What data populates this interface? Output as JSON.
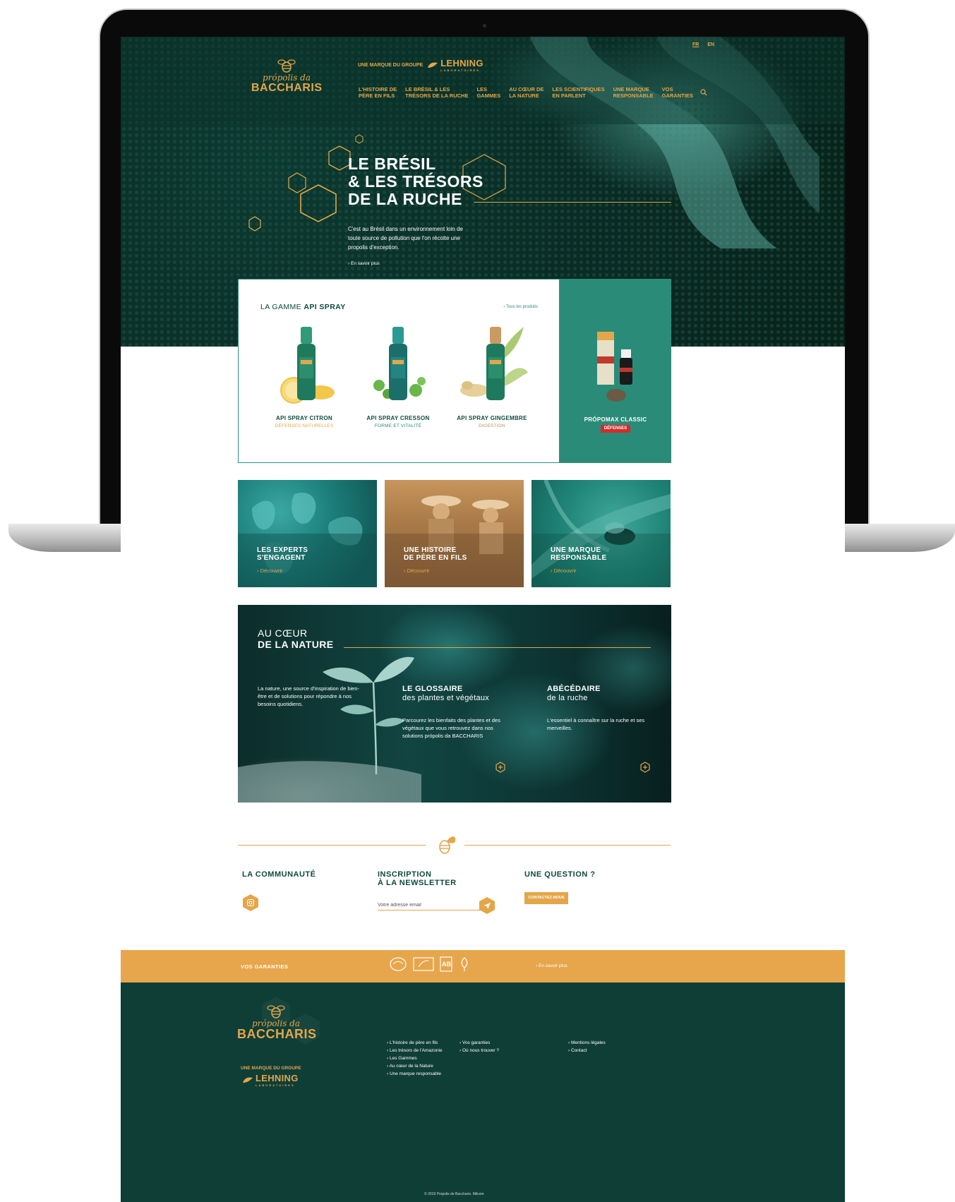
{
  "header": {
    "languages": [
      "FR",
      "EN"
    ],
    "group_label": "UNE MARQUE DU GROUPE",
    "group_brand": "LEHNING",
    "group_brand_sub": "LABORATOIRES",
    "logo_script": "própolis da",
    "logo_word": "BACCHARIS",
    "nav": [
      "L'HISTOIRE DE\nPÈRE EN FILS",
      "LE BRÉSIL & LES\nTRÉSORS DE LA RUCHE",
      "LES\nGAMMES",
      "AU CŒUR DE\nLA NATURE",
      "LES SCIENTIFIQUES\nEN PARLENT",
      "UNE MARQUE\nRESPONSABLE",
      "VOS\nGARANTIES"
    ]
  },
  "hero": {
    "title": "LE BRÉSIL\n& LES TRÉSORS\nDE LA RUCHE",
    "text": "C'est au Brésil dans un environnement loin de toute source de pollution que l'on récolte une propolis d'exception.",
    "link": "En savoir plus"
  },
  "products": {
    "title_prefix": "LA GAMME ",
    "title_bold": "API SPRAY",
    "all_link": "Tous les produits",
    "items": [
      {
        "name": "API SPRAY CITRON",
        "category": "DÉFENSES NATURELLES",
        "color": "#e4a64a"
      },
      {
        "name": "API SPRAY CRESSON",
        "category": "FORME ET VITALITÉ",
        "color": "#2a8c78"
      },
      {
        "name": "API SPRAY GINGEMBRE",
        "category": "DIGESTION",
        "color": "#b8925a"
      }
    ],
    "featured": {
      "name": "PRÓPOMAX CLASSIC",
      "badge": "DÉFENSES"
    }
  },
  "tiles": [
    {
      "label": "LES EXPERTS\nS'ENGAGENT",
      "link": "Découvrir"
    },
    {
      "label": "UNE HISTOIRE\nDE PÈRE EN FILS",
      "link": "Découvrir"
    },
    {
      "label": "UNE MARQUE\nRESPONSABLE",
      "link": "Découvrir"
    }
  ],
  "nature": {
    "title_light": "AU CŒUR",
    "title_bold": "DE LA NATURE",
    "intro": "La nature, une source d'inspiration de bien-être et de solutions pour répondre à nos besoins quotidiens.",
    "glossary_title": "LE GLOSSAIRE",
    "glossary_sub": "des plantes et végétaux",
    "glossary_text": "Parcourez les bienfaits des plantes et des végétaux que vous retrouvez dans nos solutions própolis da BACCHARIS",
    "abc_title": "ABÉCÉDAIRE",
    "abc_sub": "de la ruche",
    "abc_text": "L'essentiel à connaître sur la ruche et ses merveilles."
  },
  "community": {
    "title": "LA COMMUNAUTÉ",
    "newsletter_title": "INSCRIPTION\nÀ LA NEWSLETTER",
    "email_placeholder": "Votre adresse email",
    "question_title": "UNE QUESTION ?",
    "contact_button": "CONTACTEZ-NOUS"
  },
  "guarantees": {
    "title": "VOS GARANTIES",
    "link": "En savoir plus"
  },
  "footer": {
    "group_label": "UNE MARQUE DU GROUPE",
    "col1": [
      "L'histoire de père en fils",
      "Les trésors de l'Amazonie",
      "Les Gammes",
      "Au cœur de la Nature",
      "Une marque responsable"
    ],
    "col2": [
      "Vos garanties",
      "Où nous trouver ?"
    ],
    "col3": [
      "Mentions légales",
      "Contact"
    ],
    "copyright": "© 2019 Propolis de Baccharis. Milcom"
  }
}
